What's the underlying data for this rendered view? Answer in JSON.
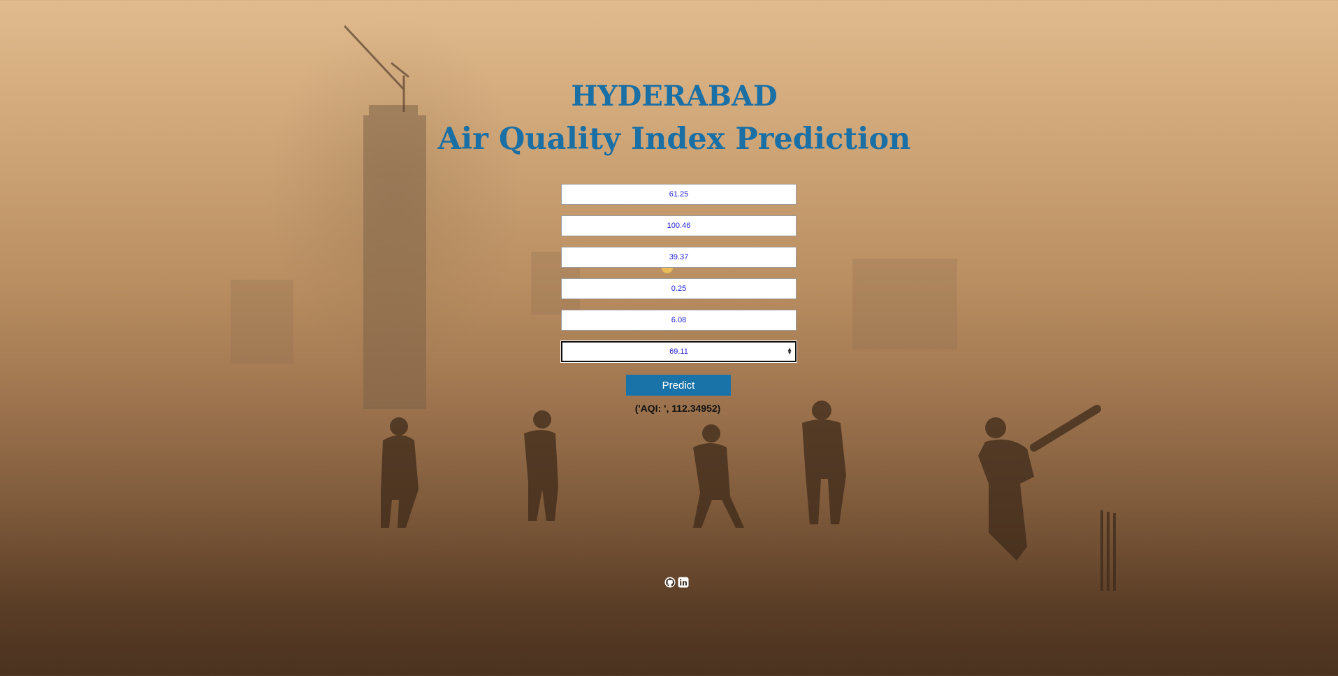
{
  "header": {
    "city": "HYDERABAD",
    "subtitle": "Air Quality Index Prediction"
  },
  "form": {
    "fields": [
      {
        "value": "61.25"
      },
      {
        "value": "100.46"
      },
      {
        "value": "39.37"
      },
      {
        "value": "0.25"
      },
      {
        "value": "6.08"
      },
      {
        "value": "69.11"
      }
    ],
    "predict_label": "Predict"
  },
  "result": {
    "text": "('AQI: ', 112.34952)"
  },
  "social": {
    "icons": [
      "github-icon",
      "linkedin-icon"
    ]
  },
  "colors": {
    "title": "#1a6fa5",
    "button": "#1a73a8",
    "input_text": "#2020d8"
  }
}
